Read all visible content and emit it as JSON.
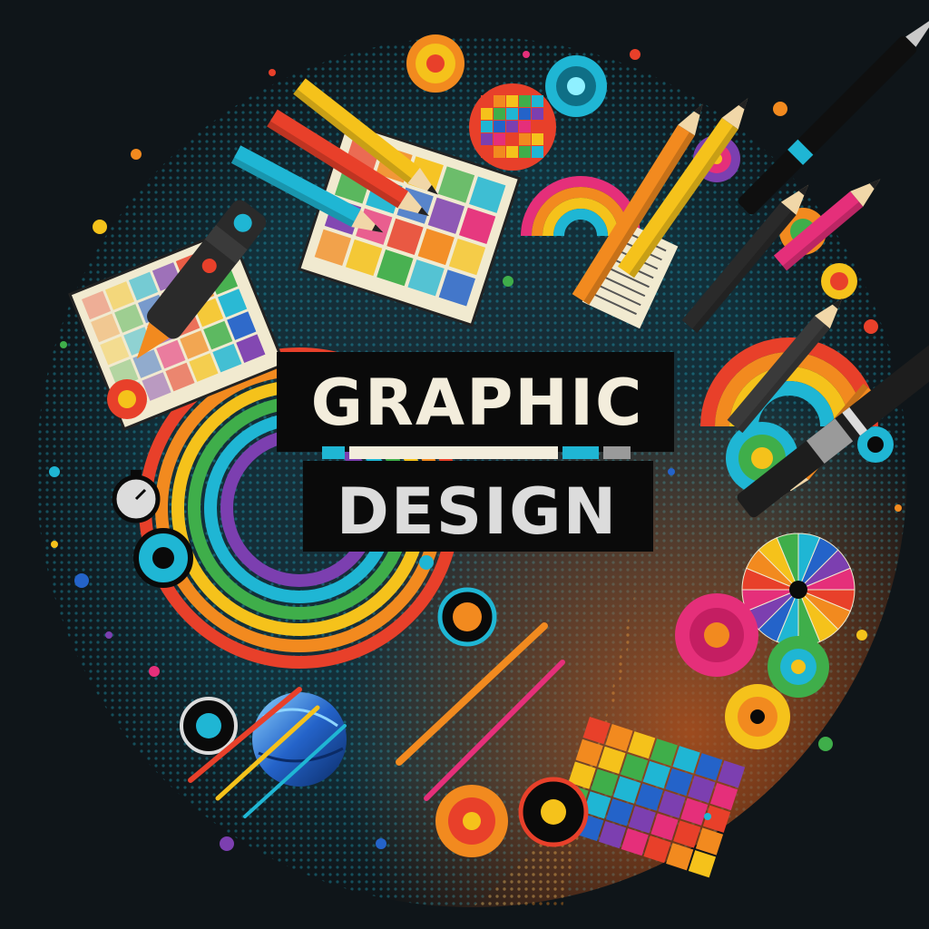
{
  "title": {
    "line1": "GRAPHIC",
    "line2": "DESIGN"
  },
  "colors": {
    "background": "#0f1519",
    "title_text_primary": "#f3eddc",
    "title_text_secondary": "#dcdcdc",
    "title_panel": "#0a0a0a",
    "accent_cyan": "#1fb6d4",
    "accent_orange": "#f28a1f",
    "accent_red": "#e8402a",
    "accent_pink": "#e52f7a",
    "accent_yellow": "#f5c21b",
    "accent_green": "#3fae4a",
    "accent_purple": "#7c3fb0",
    "accent_blue": "#2463c9"
  },
  "icons": [
    "pencil-icon",
    "pen-icon",
    "color-swatch-grid-icon",
    "color-wheel-icon",
    "globe-icon",
    "stopwatch-icon",
    "paper-roll-icon",
    "rainbow-arc-icon",
    "target-circle-icon"
  ]
}
